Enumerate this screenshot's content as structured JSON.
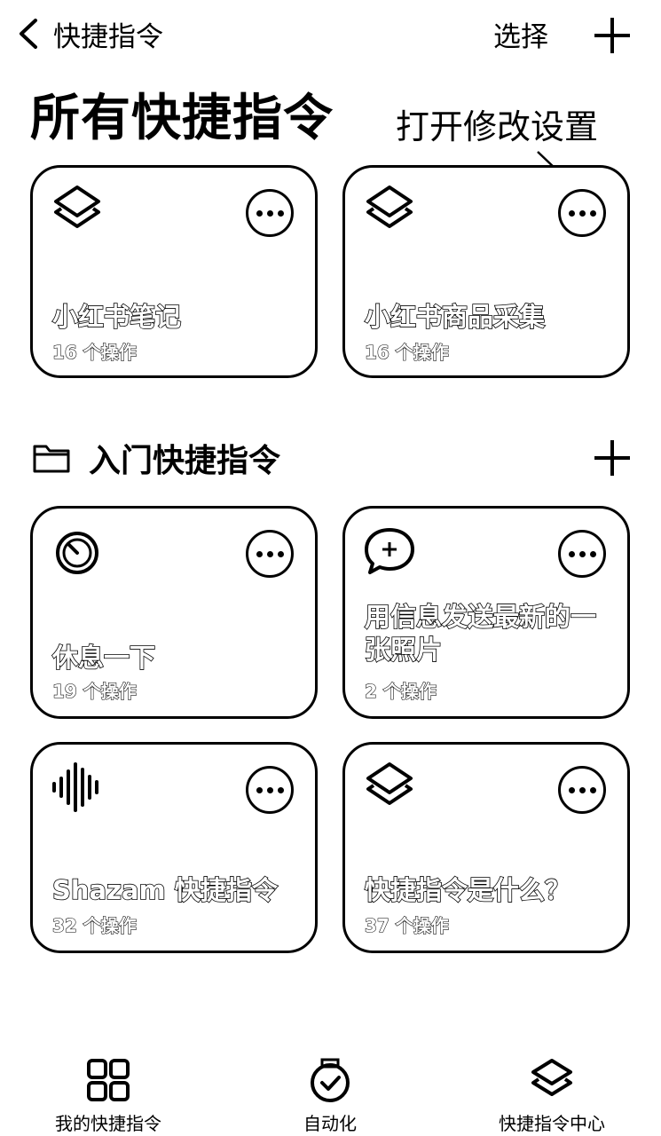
{
  "nav": {
    "back_label": "快捷指令",
    "select_label": "选择"
  },
  "page_title": "所有快捷指令",
  "annotation": "打开修改设置",
  "top_shortcuts": [
    {
      "name": "小红书笔记",
      "count": "16 个操作",
      "icon": "layers-icon"
    },
    {
      "name": "小红书商品采集",
      "count": "16 个操作",
      "icon": "layers-icon"
    }
  ],
  "folder": {
    "title": "入门快捷指令",
    "shortcuts": [
      {
        "name": "休息一下",
        "count": "19 个操作",
        "icon": "timer-icon"
      },
      {
        "name": "用信息发送最新的一张照片",
        "count": "2 个操作",
        "icon": "message-bubble-icon"
      },
      {
        "name": "Shazam 快捷指令",
        "count": "32 个操作",
        "icon": "sound-wave-icon"
      },
      {
        "name": "快捷指令是什么？",
        "count": "37 个操作",
        "icon": "layers-icon"
      }
    ]
  },
  "tabbar": {
    "items": [
      {
        "label": "我的快捷指令",
        "icon": "grid-icon"
      },
      {
        "label": "自动化",
        "icon": "automation-clock-icon"
      },
      {
        "label": "快捷指令中心",
        "icon": "gallery-layers-icon"
      }
    ]
  }
}
